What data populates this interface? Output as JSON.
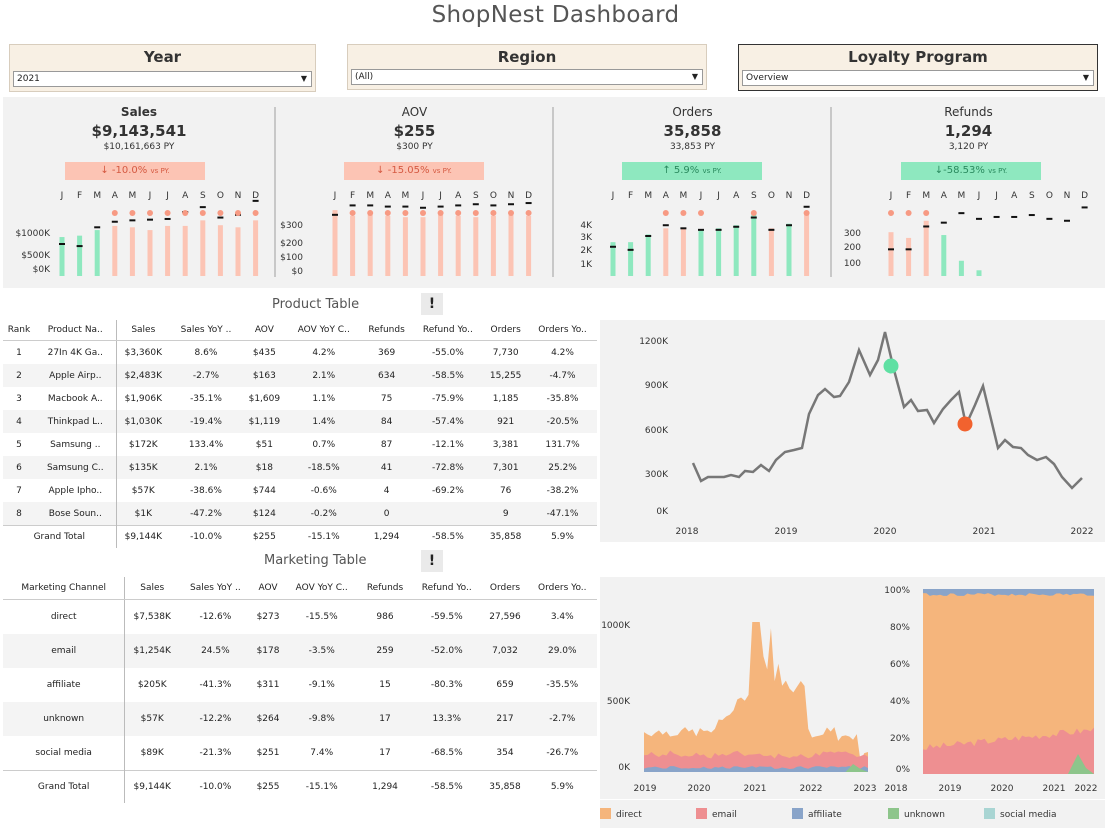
{
  "title": "ShopNest Dashboard",
  "filters": [
    {
      "label": "Year",
      "value": "2021"
    },
    {
      "label": "Region",
      "value": "(All)"
    },
    {
      "label": "Loyalty Program",
      "value": "Overview"
    }
  ],
  "months": [
    "J",
    "F",
    "M",
    "A",
    "M",
    "J",
    "J",
    "A",
    "S",
    "O",
    "N",
    "D"
  ],
  "colors": {
    "positive": "#8ee8bf",
    "negative": "#fcc4b4",
    "dot": "#f79a83",
    "line": "#7a7a7a",
    "direct": "#f5b57c",
    "email": "#ee8f91",
    "affiliate": "#89a4c9",
    "unknown": "#8dc58b",
    "social_media": "#a9d5d3"
  },
  "kpis": [
    {
      "name": "Sales",
      "value": "$9,143,541",
      "py": "$10,161,663 PY",
      "change": "↓ -10.0%",
      "vs": "vs PY.",
      "trend": "negative",
      "axis": [
        "$1000K",
        "$500K",
        "$0K"
      ],
      "cur": [
        560,
        580,
        660,
        720,
        700,
        660,
        720,
        720,
        800,
        730,
        700,
        800
      ],
      "prev": [
        460,
        430,
        700,
        780,
        800,
        810,
        820,
        920,
        990,
        840,
        880,
        1080
      ],
      "scale_max": 1150
    },
    {
      "name": "AOV",
      "value": "$255",
      "py": "$300 PY",
      "change": "↓ -15.05%",
      "vs": "vs PY.",
      "trend": "negative",
      "axis": [
        "$300",
        "$200",
        "$100",
        "$0"
      ],
      "cur": [
        280,
        255,
        260,
        255,
        250,
        250,
        260,
        255,
        250,
        255,
        260,
        255
      ],
      "prev": [
        260,
        300,
        300,
        295,
        295,
        290,
        295,
        300,
        305,
        300,
        305,
        310
      ],
      "scale_max": 340
    },
    {
      "name": "Orders",
      "value": "35,858",
      "py": "33,853 PY",
      "change": "↑ 5.9%",
      "vs": "vs PY.",
      "trend": "positive",
      "axis": [
        "4K",
        "3K",
        "2K",
        "1K"
      ],
      "cur": [
        2200,
        2200,
        2700,
        3100,
        3100,
        3000,
        3100,
        3300,
        4000,
        3100,
        3400,
        4000
      ],
      "prev": [
        1900,
        1700,
        2600,
        3300,
        3100,
        3000,
        3000,
        3200,
        3800,
        3000,
        3300,
        4500
      ],
      "scale_max": 5200
    },
    {
      "name": "Refunds",
      "value": "1,294",
      "py": "3,120 PY",
      "change": "↓-58.53%",
      "vs": "vs PY.",
      "trend": "negative",
      "axis": [
        "300",
        "200",
        "100"
      ],
      "cur": [
        230,
        200,
        290,
        215,
        80,
        30,
        0,
        0,
        0,
        0,
        0,
        0
      ],
      "prev": [
        140,
        140,
        260,
        280,
        330,
        300,
        310,
        310,
        320,
        300,
        290,
        360
      ],
      "scale_max": 420
    }
  ],
  "product_table": {
    "title": "Product Table",
    "headers": [
      "Rank",
      "Product Na..",
      "Sales",
      "Sales YoY ..",
      "AOV",
      "AOV YoY C..",
      "Refunds",
      "Refund Yo..",
      "Orders",
      "Orders Yo.."
    ],
    "rows": [
      [
        "1",
        "27In 4K Ga..",
        "$3,360K",
        "8.6%",
        "$435",
        "4.2%",
        "369",
        "-55.0%",
        "7,730",
        "4.2%"
      ],
      [
        "2",
        "Apple Airp..",
        "$2,483K",
        "-2.7%",
        "$163",
        "2.1%",
        "634",
        "-58.5%",
        "15,255",
        "-4.7%"
      ],
      [
        "3",
        "Macbook A..",
        "$1,906K",
        "-35.1%",
        "$1,609",
        "1.1%",
        "75",
        "-75.9%",
        "1,185",
        "-35.8%"
      ],
      [
        "4",
        "Thinkpad L..",
        "$1,030K",
        "-19.4%",
        "$1,119",
        "1.4%",
        "84",
        "-57.4%",
        "921",
        "-20.5%"
      ],
      [
        "5",
        "Samsung ..",
        "$172K",
        "133.4%",
        "$51",
        "0.7%",
        "87",
        "-12.1%",
        "3,381",
        "131.7%"
      ],
      [
        "6",
        "Samsung C..",
        "$135K",
        "2.1%",
        "$18",
        "-18.5%",
        "41",
        "-72.8%",
        "7,301",
        "25.2%"
      ],
      [
        "7",
        "Apple Ipho..",
        "$57K",
        "-38.6%",
        "$744",
        "-0.6%",
        "4",
        "-69.2%",
        "76",
        "-38.2%"
      ],
      [
        "8",
        "Bose Soun..",
        "$1K",
        "-47.2%",
        "$124",
        "-0.2%",
        "0",
        "",
        "9",
        "-47.1%"
      ]
    ],
    "total": [
      "Grand Total",
      "$9,144K",
      "-10.0%",
      "$255",
      "-15.1%",
      "1,294",
      "-58.5%",
      "35,858",
      "5.9%"
    ]
  },
  "line_chart": {
    "y_ticks": [
      "1200K",
      "900K",
      "600K",
      "300K",
      "0K"
    ],
    "x_ticks": [
      "2018",
      "2019",
      "2020",
      "2021",
      "2022"
    ]
  },
  "marketing_table": {
    "title": "Marketing Table",
    "headers": [
      "Marketing Channel",
      "Sales",
      "Sales YoY ..",
      "AOV",
      "AOV YoY C..",
      "Refunds",
      "Refund Yo..",
      "Orders",
      "Orders Yo.."
    ],
    "rows": [
      [
        "direct",
        "$7,538K",
        "-12.6%",
        "$273",
        "-15.5%",
        "986",
        "-59.5%",
        "27,596",
        "3.4%"
      ],
      [
        "email",
        "$1,254K",
        "24.5%",
        "$178",
        "-3.5%",
        "259",
        "-52.0%",
        "7,032",
        "29.0%"
      ],
      [
        "affiliate",
        "$205K",
        "-41.3%",
        "$311",
        "-9.1%",
        "15",
        "-80.3%",
        "659",
        "-35.5%"
      ],
      [
        "unknown",
        "$57K",
        "-12.2%",
        "$264",
        "-9.8%",
        "17",
        "13.3%",
        "217",
        "-2.7%"
      ],
      [
        "social media",
        "$89K",
        "-21.3%",
        "$251",
        "7.4%",
        "17",
        "-68.5%",
        "354",
        "-26.7%"
      ]
    ],
    "total": [
      "Grand Total",
      "$9,144K",
      "-10.0%",
      "$255",
      "-15.1%",
      "1,294",
      "-58.5%",
      "35,858",
      "5.9%"
    ]
  },
  "area_chart": {
    "y_ticks": [
      "1000K",
      "500K",
      "0K"
    ],
    "x_ticks": [
      "2019",
      "2020",
      "2021",
      "2022",
      "2023"
    ]
  },
  "share_chart": {
    "y_ticks": [
      "100%",
      "80%",
      "60%",
      "40%",
      "20%",
      "0%"
    ],
    "x_ticks": [
      "2018",
      "2019",
      "2020",
      "2021",
      "2022"
    ]
  },
  "legend": [
    {
      "label": "direct",
      "color": "#f5b57c"
    },
    {
      "label": "email",
      "color": "#ee8f91"
    },
    {
      "label": "affiliate",
      "color": "#89a4c9"
    },
    {
      "label": "unknown",
      "color": "#8dc58b"
    },
    {
      "label": "social media",
      "color": "#a9d5d3"
    }
  ],
  "chart_data": [
    {
      "type": "line",
      "x": [
        "2018-06",
        "2018-09",
        "2019-01",
        "2019-06",
        "2020-01",
        "2020-06",
        "2021-01",
        "2021-06",
        "2022-01"
      ],
      "values": [
        360,
        270,
        300,
        700,
        1000,
        730,
        800,
        450,
        260
      ],
      "ylim": [
        0,
        1200
      ],
      "unit": "K"
    },
    {
      "type": "area",
      "series": [
        {
          "name": "direct"
        },
        {
          "name": "email"
        },
        {
          "name": "affiliate"
        },
        {
          "name": "unknown"
        },
        {
          "name": "social media"
        }
      ],
      "ylim": [
        0,
        1200
      ]
    },
    {
      "type": "area",
      "series": [
        {
          "name": "direct"
        },
        {
          "name": "email"
        },
        {
          "name": "affiliate"
        },
        {
          "name": "unknown"
        },
        {
          "name": "social media"
        }
      ],
      "ylim": [
        0,
        100
      ],
      "unit": "%"
    }
  ]
}
